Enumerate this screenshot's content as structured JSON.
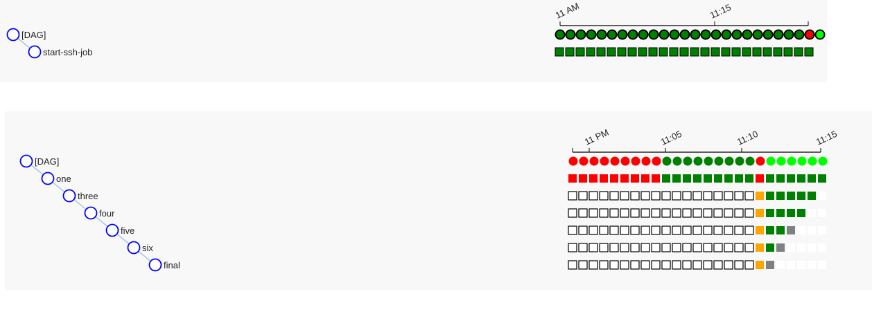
{
  "colors": {
    "success": "#008000",
    "failed": "#ff0000",
    "running": "#00ff00",
    "queued": "#808080",
    "upstream_failed": "#ffa500",
    "no_status": "#ffffff",
    "tree_node": "#0000ff",
    "tree_link": "#a9c7e8"
  },
  "dags": [
    {
      "time_labels": [
        "11 AM",
        "11:15"
      ],
      "tasks": [
        {
          "label": "[DAG]",
          "depth": 0
        },
        {
          "label": "start-ssh-job",
          "depth": 1
        }
      ],
      "dag_runs": [
        "success",
        "success",
        "success",
        "success",
        "success",
        "success",
        "success",
        "success",
        "success",
        "success",
        "success",
        "success",
        "success",
        "success",
        "success",
        "success",
        "success",
        "success",
        "success",
        "success",
        "success",
        "success",
        "success",
        "success",
        "failed",
        "running"
      ],
      "task_instances": [
        [
          "success",
          "success",
          "success",
          "success",
          "success",
          "success",
          "success",
          "success",
          "success",
          "success",
          "success",
          "success",
          "success",
          "success",
          "success",
          "success",
          "success",
          "success",
          "success",
          "success",
          "success",
          "success",
          "success",
          "success",
          "success"
        ]
      ]
    },
    {
      "time_labels": [
        "11 PM",
        "11:05",
        "11:10",
        "11:15"
      ],
      "tasks": [
        {
          "label": "[DAG]",
          "depth": 0
        },
        {
          "label": "one",
          "depth": 1
        },
        {
          "label": "three",
          "depth": 2
        },
        {
          "label": "four",
          "depth": 3
        },
        {
          "label": "five",
          "depth": 4
        },
        {
          "label": "six",
          "depth": 5
        },
        {
          "label": "final",
          "depth": 6
        }
      ],
      "dag_runs": [
        "failed",
        "failed",
        "failed",
        "failed",
        "failed",
        "failed",
        "failed",
        "failed",
        "failed",
        "success",
        "success",
        "success",
        "success",
        "success",
        "success",
        "success",
        "success",
        "success",
        "failed",
        "running",
        "running",
        "running",
        "running",
        "running",
        "running"
      ],
      "task_instances": [
        [
          "failed",
          "failed",
          "failed",
          "failed",
          "failed",
          "failed",
          "failed",
          "failed",
          "failed",
          "success",
          "success",
          "success",
          "success",
          "success",
          "success",
          "success",
          "success",
          "success",
          "failed",
          "success",
          "success",
          "success",
          "success",
          "success",
          "success"
        ],
        [
          "no_status",
          "no_status",
          "no_status",
          "no_status",
          "no_status",
          "no_status",
          "no_status",
          "no_status",
          "no_status",
          "no_status",
          "no_status",
          "no_status",
          "no_status",
          "no_status",
          "no_status",
          "no_status",
          "no_status",
          "no_status",
          "upstream_failed",
          "success",
          "success",
          "success",
          "success",
          "success",
          "none"
        ],
        [
          "no_status",
          "no_status",
          "no_status",
          "no_status",
          "no_status",
          "no_status",
          "no_status",
          "no_status",
          "no_status",
          "no_status",
          "no_status",
          "no_status",
          "no_status",
          "no_status",
          "no_status",
          "no_status",
          "no_status",
          "no_status",
          "upstream_failed",
          "success",
          "success",
          "success",
          "success",
          "none",
          "none"
        ],
        [
          "no_status",
          "no_status",
          "no_status",
          "no_status",
          "no_status",
          "no_status",
          "no_status",
          "no_status",
          "no_status",
          "no_status",
          "no_status",
          "no_status",
          "no_status",
          "no_status",
          "no_status",
          "no_status",
          "no_status",
          "no_status",
          "upstream_failed",
          "success",
          "success",
          "queued",
          "none",
          "none",
          "none"
        ],
        [
          "no_status",
          "no_status",
          "no_status",
          "no_status",
          "no_status",
          "no_status",
          "no_status",
          "no_status",
          "no_status",
          "no_status",
          "no_status",
          "no_status",
          "no_status",
          "no_status",
          "no_status",
          "no_status",
          "no_status",
          "no_status",
          "upstream_failed",
          "success",
          "queued",
          "none",
          "none",
          "none",
          "none"
        ],
        [
          "no_status",
          "no_status",
          "no_status",
          "no_status",
          "no_status",
          "no_status",
          "no_status",
          "no_status",
          "no_status",
          "no_status",
          "no_status",
          "no_status",
          "no_status",
          "no_status",
          "no_status",
          "no_status",
          "no_status",
          "no_status",
          "upstream_failed",
          "queued",
          "none",
          "none",
          "none",
          "none",
          "none"
        ]
      ]
    }
  ]
}
